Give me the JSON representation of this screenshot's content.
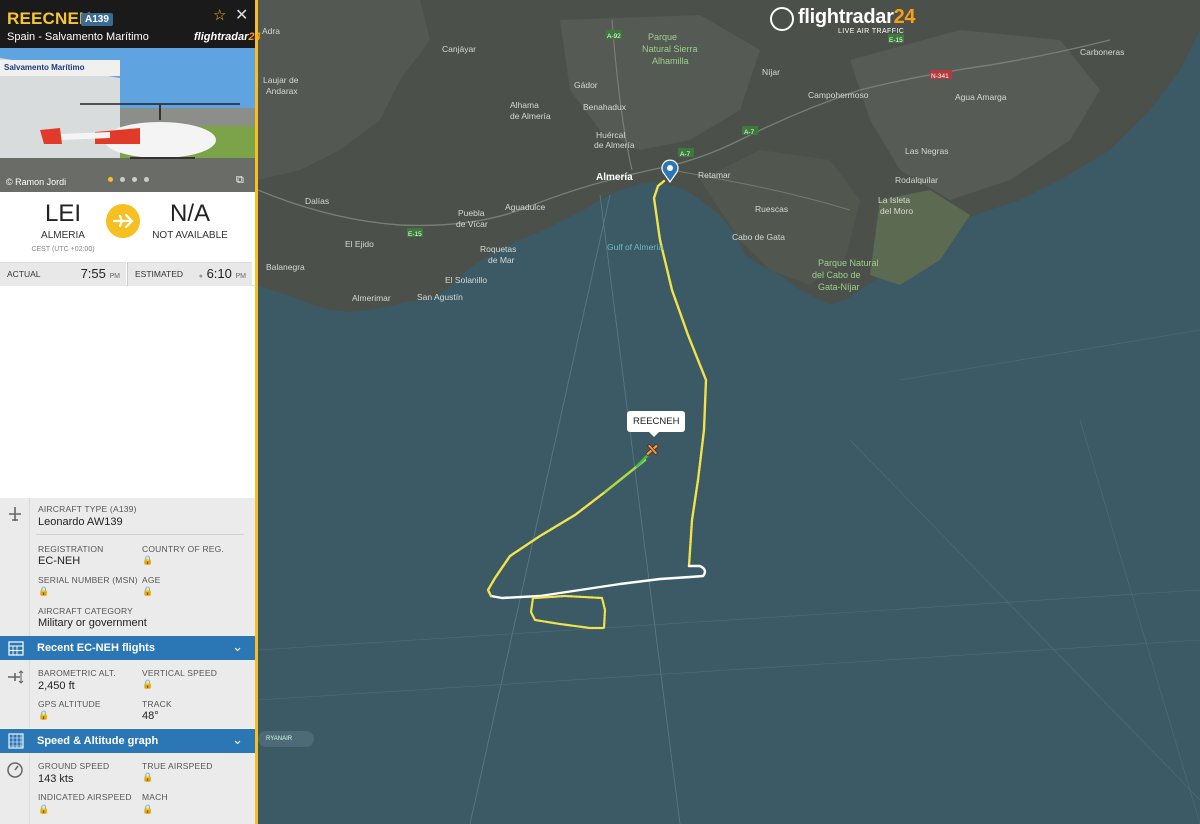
{
  "flight": {
    "callsign": "REECNEH",
    "type_badge": "A139",
    "operator": "Spain - Salvamento Marítimo",
    "brand_small": "flightradar",
    "brand_small_num": "24"
  },
  "logo": {
    "word": "flightradar",
    "num": "24",
    "sub": "LIVE AIR TRAFFIC"
  },
  "photo": {
    "credit": "© Ramon Jordi",
    "hangar_sign": "Salvamento Marítimo",
    "dots": 4,
    "active_dot": 0
  },
  "route": {
    "origin_code": "LEI",
    "origin_name": "ALMERIA",
    "origin_tz": "CEST (UTC +02:00)",
    "dest_code": "N/A",
    "dest_name": "NOT AVAILABLE",
    "actual_label": "ACTUAL",
    "actual_time": "7:55",
    "actual_ampm": "PM",
    "est_label": "ESTIMATED",
    "est_time": "6:10",
    "est_ampm": "PM"
  },
  "aircraft": {
    "type_label": "AIRCRAFT TYPE",
    "type_code": "(A139)",
    "type_val": "Leonardo AW139",
    "reg_label": "REGISTRATION",
    "reg_val": "EC-NEH",
    "country_label": "COUNTRY OF REG.",
    "serial_label": "SERIAL NUMBER (MSN)",
    "age_label": "AGE",
    "category_label": "AIRCRAFT CATEGORY",
    "category_val": "Military or government"
  },
  "recent_bar": "Recent EC-NEH flights",
  "altitude": {
    "baro_label": "BAROMETRIC ALT.",
    "baro_val": "2,450 ft",
    "vs_label": "VERTICAL SPEED",
    "gps_label": "GPS ALTITUDE",
    "track_label": "TRACK",
    "track_val": "48°"
  },
  "graph_bar": "Speed & Altitude graph",
  "speed": {
    "gs_label": "GROUND SPEED",
    "gs_val": "143 kts",
    "tas_label": "TRUE AIRSPEED",
    "ias_label": "INDICATED AIRSPEED",
    "mach_label": "MACH"
  },
  "map": {
    "aircraft_label": "REECNEH",
    "ryanair": "RYANAIR",
    "places": [
      "Adra",
      "El Ejido",
      "Dalías",
      "Balanegra",
      "Almerimar",
      "San Agustín",
      "El Solanillo",
      "Roquetas de Mar",
      "Aguadulce",
      "Puebla de Vícar",
      "Almería",
      "Retamar",
      "Ruescas",
      "Cabo de Gata",
      "Las Negras",
      "Rodalquilar",
      "La Isleta del Moro",
      "Agua Amarga",
      "Carboneras",
      "Níjar",
      "Campohermoso",
      "Gádor",
      "Benahadux",
      "Huércal de Almería",
      "Alhama de Almería",
      "Laujar de Andarax",
      "Canjáyar",
      "Gulf of Almería"
    ],
    "parks": [
      "Parque Natural Sierra Alhamilla",
      "Parque Natural del Cabo de Gata-Níjar"
    ],
    "roads": [
      "A-7",
      "A-7",
      "E-15",
      "N-341",
      "A-92",
      "E-15"
    ]
  },
  "colors": {
    "accent": "#f6c022",
    "bar": "#2b77b5",
    "sea": "#3b5a66",
    "land": "#4a4f4a"
  }
}
